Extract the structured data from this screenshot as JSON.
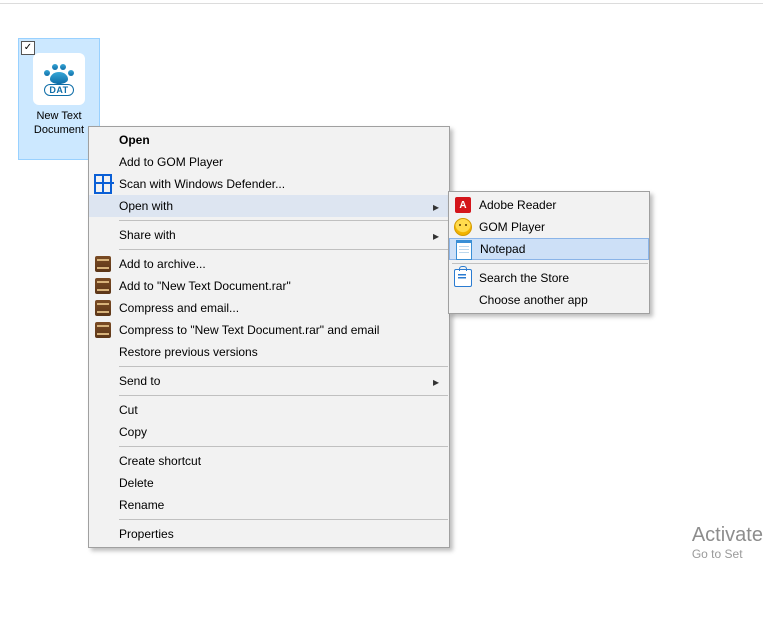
{
  "file": {
    "name_line1": "New Text",
    "name_line2": "Document",
    "badge": "DAT"
  },
  "menu": {
    "open": "Open",
    "add_gom": "Add to GOM Player",
    "scan_defender": "Scan with Windows Defender...",
    "open_with": "Open with",
    "share_with": "Share with",
    "add_archive": "Add to archive...",
    "add_rar": "Add to \"New Text Document.rar\"",
    "compress_email": "Compress and email...",
    "compress_rar_email": "Compress to \"New Text Document.rar\" and email",
    "restore": "Restore previous versions",
    "send_to": "Send to",
    "cut": "Cut",
    "copy": "Copy",
    "create_shortcut": "Create shortcut",
    "delete": "Delete",
    "rename": "Rename",
    "properties": "Properties"
  },
  "submenu": {
    "adobe": "Adobe Reader",
    "gom": "GOM Player",
    "notepad": "Notepad",
    "search_store": "Search the Store",
    "choose_another": "Choose another app"
  },
  "watermark": {
    "title": "Activate",
    "sub": "Go to Set"
  }
}
